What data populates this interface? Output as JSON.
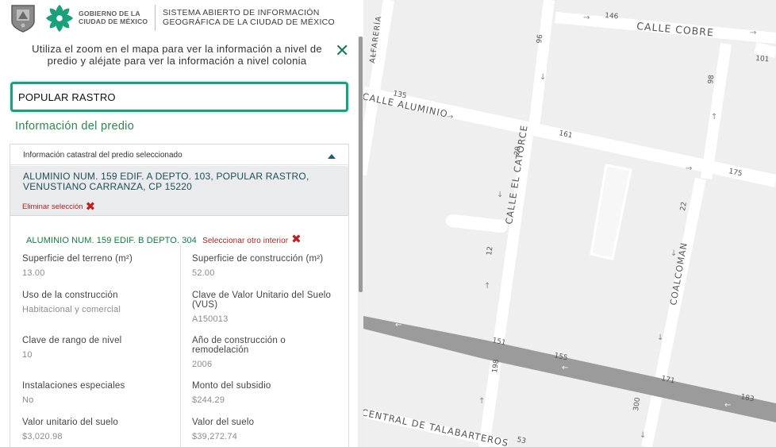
{
  "header": {
    "gov_line1": "GOBIERNO DE LA",
    "gov_line2": "CIUDAD DE MÉXICO",
    "system_line1": "SISTEMA ABIERTO DE INFORMACIÓN",
    "system_line2": "GEOGRÁFICA DE LA CIUDAD DE MÉXICO"
  },
  "panel": {
    "hint": "Utiliza el zoom en el mapa para ver la información a nivel de predio y aléjate para ver la información a nivel colonia",
    "close_icon": "close-icon",
    "search_value": "POPULAR RASTRO",
    "info_title": "Información del predio",
    "card_header": "Información catastral del predio seleccionado",
    "address": "ALUMINIO NUM. 159 EDIF. A DEPTO. 103, POPULAR RASTRO, VENUSTIANO CARRANZA, CP 15220",
    "remove_label": "Eliminar selección",
    "interior_label": "ALUMINIO NUM. 159 EDIF. B DEPTO. 304",
    "select_other_label": "Seleccionar otro interior",
    "fields": {
      "sup_terreno": {
        "label": "Superficie del terreno (m²)",
        "value": "13.00"
      },
      "sup_construccion": {
        "label": "Superficie de construcción (m²)",
        "value": "52.00"
      },
      "uso": {
        "label": "Uso de la construcción",
        "value": "Habitacional y comercial"
      },
      "vus": {
        "label": "Clave de Valor Unitario del Suelo (VUS)",
        "value": "A150013"
      },
      "rango_nivel": {
        "label": "Clave de rango de nivel",
        "value": "10"
      },
      "anio": {
        "label": "Año de construcción o remodelación",
        "value": "2006"
      },
      "instalaciones": {
        "label": "Instalaciones especiales",
        "value": "No"
      },
      "subsidio": {
        "label": "Monto del subsidio",
        "value": "$244.29"
      },
      "valor_unitario": {
        "label": "Valor unitario del suelo",
        "value": "$3,020.98"
      },
      "valor_suelo": {
        "label": "Valor del suelo",
        "value": "$39,272.74"
      }
    }
  },
  "map": {
    "streets": {
      "cobre": "CALLE COBRE",
      "aluminio": "CALLE ALUMINIO",
      "catorce": "CALLE EL CATORCE",
      "coalcoman": "COALCOMAN",
      "talabarteros": "CENTRAL DE TALABARTEROS",
      "alfareria": "ALFARERÍA",
      "aluminio_partial": "ALUMINIO"
    },
    "numbers": [
      "146",
      "96",
      "101",
      "98",
      "135",
      "161",
      "175",
      "20",
      "22",
      "12",
      "151",
      "155",
      "198",
      "171",
      "183",
      "300",
      "53"
    ],
    "pin_icon": "map-marker-icon",
    "colors": {
      "accent": "#1b9e82",
      "pin": "#2b7cc4",
      "green_text": "#2b8a4e",
      "red": "#c41e1e"
    }
  }
}
